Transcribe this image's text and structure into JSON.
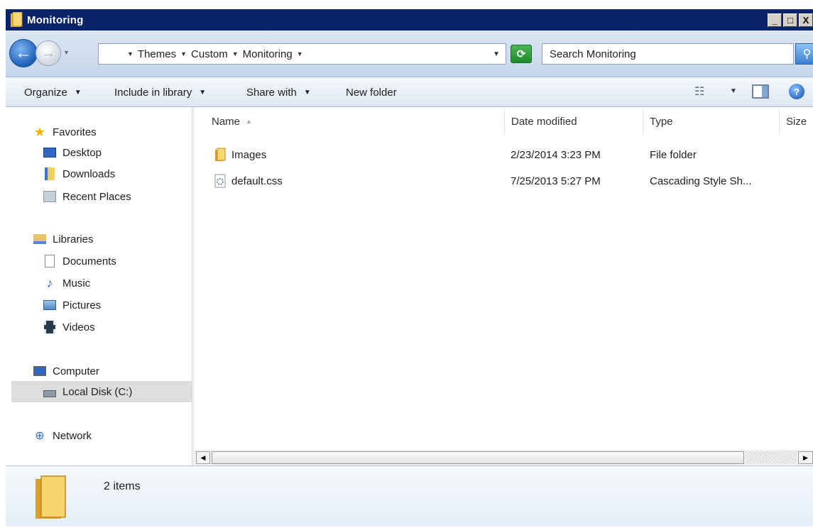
{
  "window": {
    "title": "Monitoring",
    "controls": {
      "minimize": "_",
      "maximize": "□",
      "close": "X"
    }
  },
  "address_bar": {
    "breadcrumbs": [
      "Themes",
      "Custom",
      "Monitoring"
    ],
    "search_placeholder": "Search Monitoring"
  },
  "toolbar": {
    "organize": "Organize",
    "include_in_library": "Include in library",
    "share_with": "Share with",
    "new_folder": "New folder"
  },
  "nav": {
    "favorites": {
      "label": "Favorites",
      "items": [
        "Desktop",
        "Downloads",
        "Recent Places"
      ]
    },
    "libraries": {
      "label": "Libraries",
      "items": [
        "Documents",
        "Music",
        "Pictures",
        "Videos"
      ]
    },
    "computer": {
      "label": "Computer",
      "items": [
        "Local Disk (C:)"
      ]
    },
    "network": {
      "label": "Network"
    },
    "selected": "Local Disk (C:)"
  },
  "columns": {
    "name": "Name",
    "date_modified": "Date modified",
    "type": "Type",
    "size": "Size"
  },
  "files": [
    {
      "name": "Images",
      "date": "2/23/2014 3:23 PM",
      "type": "File folder",
      "icon": "folder-icon"
    },
    {
      "name": "default.css",
      "date": "7/25/2013 5:27 PM",
      "type": "Cascading Style Sh...",
      "icon": "css-file-icon"
    }
  ],
  "status": {
    "item_count": "2 items"
  },
  "colors": {
    "titlebar": "#0a246a",
    "selected_nav": "#dedede",
    "folder": "#f3cf5c"
  }
}
